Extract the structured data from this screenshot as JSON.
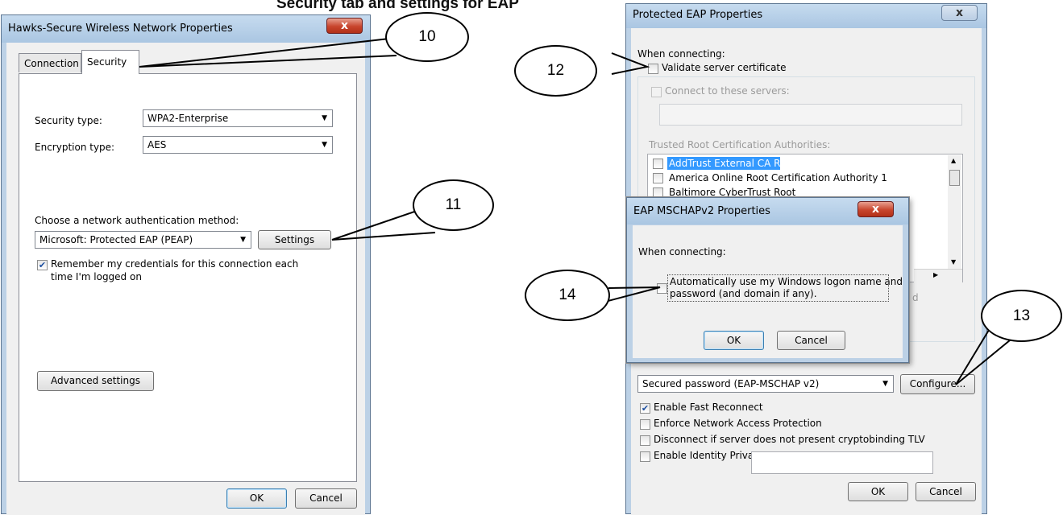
{
  "heading": "Security tab and settings for EAP",
  "left_dialog": {
    "title": "Hawks-Secure Wireless Network Properties",
    "close_glyph": "x",
    "tabs": [
      {
        "label": "Connection"
      },
      {
        "label": "Security"
      }
    ],
    "security_type_label": "Security type:",
    "security_type_value": "WPA2-Enterprise",
    "encryption_type_label": "Encryption type:",
    "encryption_type_value": "AES",
    "auth_method_label": "Choose a network authentication method:",
    "auth_method_value": "Microsoft: Protected EAP (PEAP)",
    "settings_button": "Settings",
    "remember_line1": "Remember my credentials for this connection each",
    "remember_line2": "time I'm logged on",
    "remember_checked": true,
    "advanced_button": "Advanced settings",
    "ok_button": "OK",
    "cancel_button": "Cancel"
  },
  "peap_dialog": {
    "title": "Protected EAP Properties",
    "close_glyph": "x",
    "when_connecting": "When connecting:",
    "validate_cert": "Validate server certificate",
    "connect_servers": "Connect to these servers:",
    "trusted_root": "Trusted Root Certification Authorities:",
    "ca_list": [
      {
        "name": "AddTrust External CA Root"
      },
      {
        "name": "America Online Root Certification Authority 1"
      },
      {
        "name": "Baltimore CyberTrust Root"
      }
    ],
    "partial_text": "d",
    "auth_method_value": "Secured password (EAP-MSCHAP v2)",
    "configure_button": "Configure...",
    "fast_reconnect": "Enable Fast Reconnect",
    "fast_reconnect_checked": true,
    "enforce_nap": "Enforce Network Access Protection",
    "disconnect_crypto": "Disconnect if server does not present cryptobinding TLV",
    "identity_privacy": "Enable Identity Privacy",
    "ok_button": "OK",
    "cancel_button": "Cancel"
  },
  "mschap_dialog": {
    "title": "EAP MSCHAPv2 Properties",
    "close_glyph": "x",
    "when_connecting": "When connecting:",
    "auto_logon_line1": "Automatically use my Windows logon name and",
    "auto_logon_line2": "password (and domain if any).",
    "ok_button": "OK",
    "cancel_button": "Cancel"
  },
  "callouts": [
    {
      "label": "10"
    },
    {
      "label": "11"
    },
    {
      "label": "12"
    },
    {
      "label": "13"
    },
    {
      "label": "14"
    }
  ],
  "colors": {
    "window_frame": "#bcd1e6",
    "close_button": "#c8452d",
    "selection": "#3399ff"
  }
}
